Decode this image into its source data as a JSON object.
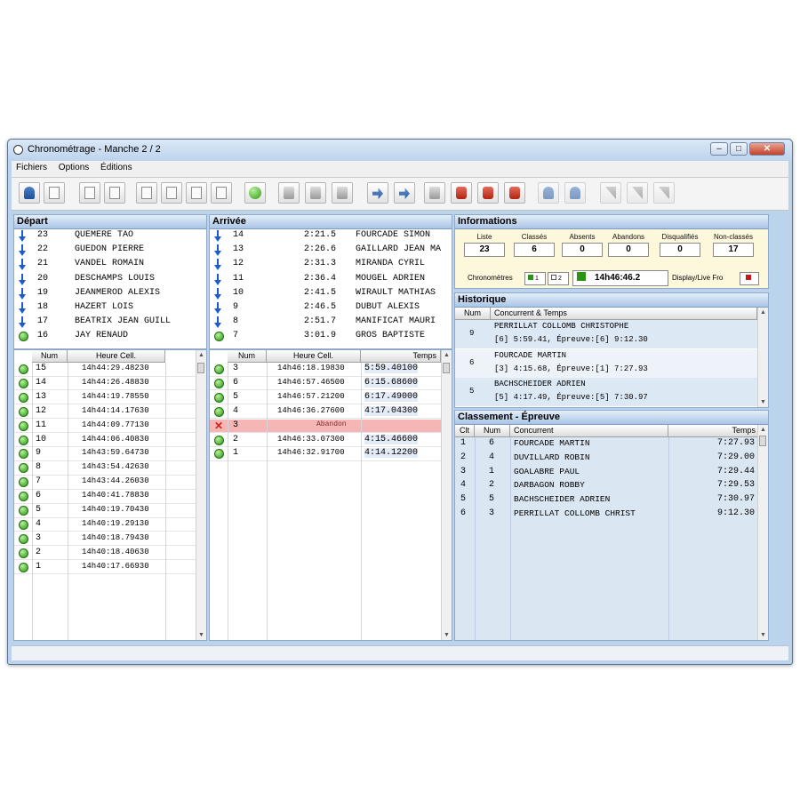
{
  "window": {
    "title": "Chronométrage -  Manche 2 / 2",
    "min_glyph": "–",
    "max_glyph": "□",
    "close_glyph": "✕"
  },
  "menu": [
    "Fichiers",
    "Options",
    "Éditions"
  ],
  "toolbar_icons": [
    "person-icon",
    "document-icon",
    "document-icon",
    "refresh-icon",
    "document-icon",
    "document-icon",
    "document-icon",
    "document-icon",
    "start-green-icon",
    "print-icon",
    "print-icon",
    "print-icon",
    "arrow-person-icon",
    "arrow-person-icon",
    "print-icon",
    "printer-red-icon",
    "printer-red-icon",
    "delete-red-icon",
    "person-faded-icon",
    "person-faded-icon",
    "flag-icon",
    "flag-icon",
    "flag-icon"
  ],
  "depart": {
    "title": "Départ",
    "queue": [
      {
        "num": "23",
        "name": "QUEMERE TAO",
        "status": "down"
      },
      {
        "num": "22",
        "name": "GUEDON PIERRE",
        "status": "down"
      },
      {
        "num": "21",
        "name": "VANDEL ROMAIN",
        "status": "down"
      },
      {
        "num": "20",
        "name": "DESCHAMPS LOUIS",
        "status": "down"
      },
      {
        "num": "19",
        "name": "JEANMEROD ALEXIS",
        "status": "down"
      },
      {
        "num": "18",
        "name": "HAZERT LOIS",
        "status": "down"
      },
      {
        "num": "17",
        "name": "BEATRIX JEAN GUILL",
        "status": "down"
      },
      {
        "num": "16",
        "name": "JAY RENAUD",
        "status": "green"
      }
    ],
    "columns": [
      "Num",
      "Heure Cell."
    ],
    "rows": [
      {
        "num": "15",
        "time": "14h44:29.48230"
      },
      {
        "num": "14",
        "time": "14h44:26.48830"
      },
      {
        "num": "13",
        "time": "14h44:19.78550"
      },
      {
        "num": "12",
        "time": "14h44:14.17630"
      },
      {
        "num": "11",
        "time": "14h44:09.77130"
      },
      {
        "num": "10",
        "time": "14h44:06.40830"
      },
      {
        "num": "9",
        "time": "14h43:59.64730"
      },
      {
        "num": "8",
        "time": "14h43:54.42630"
      },
      {
        "num": "7",
        "time": "14h43:44.26030"
      },
      {
        "num": "6",
        "time": "14h40:41.78830"
      },
      {
        "num": "5",
        "time": "14h40:19.70430"
      },
      {
        "num": "4",
        "time": "14h40:19.29130"
      },
      {
        "num": "3",
        "time": "14h40:18.79430"
      },
      {
        "num": "2",
        "time": "14h40:18.40630"
      },
      {
        "num": "1",
        "time": "14h40:17.66930"
      }
    ]
  },
  "arrivee": {
    "title": "Arrivée",
    "queue": [
      {
        "num": "14",
        "time": "2:21.5",
        "name": "FOURCADE SIMON",
        "status": "down"
      },
      {
        "num": "13",
        "time": "2:26.6",
        "name": "GAILLARD JEAN MA",
        "status": "down"
      },
      {
        "num": "12",
        "time": "2:31.3",
        "name": "MIRANDA CYRIL",
        "status": "down"
      },
      {
        "num": "11",
        "time": "2:36.4",
        "name": "MOUGEL ADRIEN",
        "status": "down"
      },
      {
        "num": "10",
        "time": "2:41.5",
        "name": "WIRAULT MATHIAS",
        "status": "down"
      },
      {
        "num": "9",
        "time": "2:46.5",
        "name": "DUBUT ALEXIS",
        "status": "down"
      },
      {
        "num": "8",
        "time": "2:51.7",
        "name": "MANIFICAT MAURI",
        "status": "down"
      },
      {
        "num": "7",
        "time": "3:01.9",
        "name": "GROS BAPTISTE",
        "status": "green"
      }
    ],
    "columns": [
      "Num",
      "Heure Cell.",
      "Temps"
    ],
    "rows": [
      {
        "num": "3",
        "time": "14h46:18.19830",
        "temps": "5:59.40100",
        "status": "ok"
      },
      {
        "num": "6",
        "time": "14h46:57.46500",
        "temps": "6:15.68600",
        "status": "ok"
      },
      {
        "num": "5",
        "time": "14h46:57.21200",
        "temps": "6:17.49000",
        "status": "ok"
      },
      {
        "num": "4",
        "time": "14h46:36.27600",
        "temps": "4:17.04300",
        "status": "ok"
      },
      {
        "num": "3",
        "time": "Abandon",
        "temps": "",
        "status": "abandon"
      },
      {
        "num": "2",
        "time": "14h46:33.07300",
        "temps": "4:15.46600",
        "status": "ok"
      },
      {
        "num": "1",
        "time": "14h46:32.91700",
        "temps": "4:14.12200",
        "status": "ok"
      }
    ]
  },
  "informations": {
    "title": "Informations",
    "stats": [
      {
        "label": "Liste",
        "value": "23"
      },
      {
        "label": "Classés",
        "value": "6"
      },
      {
        "label": "Absents",
        "value": "0"
      },
      {
        "label": "Abandons",
        "value": "0"
      },
      {
        "label": "Disqualifiés",
        "value": "0"
      },
      {
        "label": "Non-classés",
        "value": "17"
      }
    ],
    "chrono_label": "Chronomètres",
    "chrono1": "1",
    "chrono2": "2",
    "clock": "14h46:46.2",
    "display_label": "Display/Live Fro"
  },
  "historique": {
    "title": "Historique",
    "columns": [
      "Num",
      "Concurrent & Temps"
    ],
    "entries": [
      {
        "num": "9",
        "line1": "PERRILLAT COLLOMB CHRISTOPHE",
        "line2": "[6] 5:59.41, Épreuve:[6] 9:12.30"
      },
      {
        "num": "6",
        "line1": "FOURCADE MARTIN",
        "line2": "[3] 4:15.68, Épreuve:[1] 7:27.93"
      },
      {
        "num": "5",
        "line1": "BACHSCHEIDER ADRIEN",
        "line2": "[5] 4:17.49, Épreuve:[5] 7:30.97"
      }
    ]
  },
  "classement": {
    "title": "Classement - Épreuve",
    "columns": [
      "Clt",
      "Num",
      "Concurrent",
      "Temps"
    ],
    "rows": [
      {
        "clt": "1",
        "num": "6",
        "name": "FOURCADE MARTIN",
        "temps": "7:27.93"
      },
      {
        "clt": "2",
        "num": "4",
        "name": "DUVILLARD ROBIN",
        "temps": "7:29.00"
      },
      {
        "clt": "3",
        "num": "1",
        "name": "GOALABRE PAUL",
        "temps": "7:29.44"
      },
      {
        "clt": "4",
        "num": "2",
        "name": "DARBAGON ROBBY",
        "temps": "7:29.53"
      },
      {
        "clt": "5",
        "num": "5",
        "name": "BACHSCHEIDER ADRIEN",
        "temps": "7:30.97"
      },
      {
        "clt": "6",
        "num": "3",
        "name": "PERRILLAT COLLOMB CHRIST",
        "temps": "9:12.30"
      }
    ]
  },
  "colors": {
    "window_bg": "#bcd3ec",
    "info_bg": "#fdf7dc",
    "abandon_row": "#f6b6b6",
    "selection": "#c2d6f0",
    "green_led": "#2b9513",
    "arrow_blue": "#1c5bc8"
  }
}
